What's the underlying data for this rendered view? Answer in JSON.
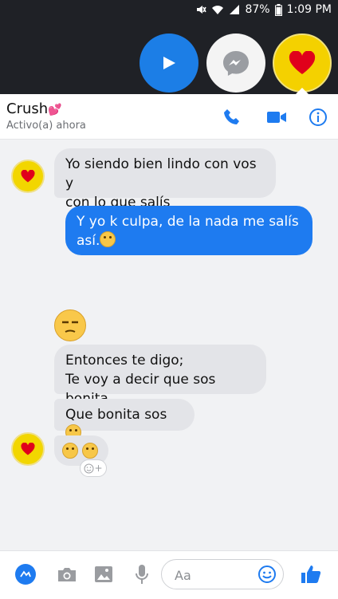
{
  "status_bar": {
    "battery": "87%",
    "time": "1:09 PM"
  },
  "bubble_heads": [
    {
      "name": "play-bubble",
      "icon": "play-icon"
    },
    {
      "name": "messenger-bubble",
      "icon": "messenger-icon"
    },
    {
      "name": "heart-bubble",
      "icon": "heart-icon"
    }
  ],
  "header": {
    "contact_name": "Crush",
    "contact_emoji": "💕",
    "status": "Activo(a) ahora",
    "icons": [
      "phone-icon",
      "video-icon",
      "info-icon"
    ]
  },
  "messages": [
    {
      "direction": "in",
      "text_line1": "Yo siendo bien lindo con vos y",
      "text_line2": "con lo que salís"
    },
    {
      "direction": "out",
      "text_line1": "Y yo k culpa, de la nada me salís",
      "text_line2": "así."
    },
    {
      "direction": "in",
      "text_line1": "Entonces te digo;",
      "text_line2": "Te voy a decir que sos bonita"
    },
    {
      "direction": "in",
      "text": "Que bonita sos"
    }
  ],
  "reaction": "+",
  "composer": {
    "placeholder": "Aa",
    "icons": [
      "menu-icon",
      "camera-icon",
      "image-icon",
      "mic-icon",
      "emoji-icon",
      "like-icon"
    ]
  },
  "colors": {
    "accent": "#1e7bf0",
    "avatar": "#f2d600",
    "heart": "#e0001b"
  }
}
